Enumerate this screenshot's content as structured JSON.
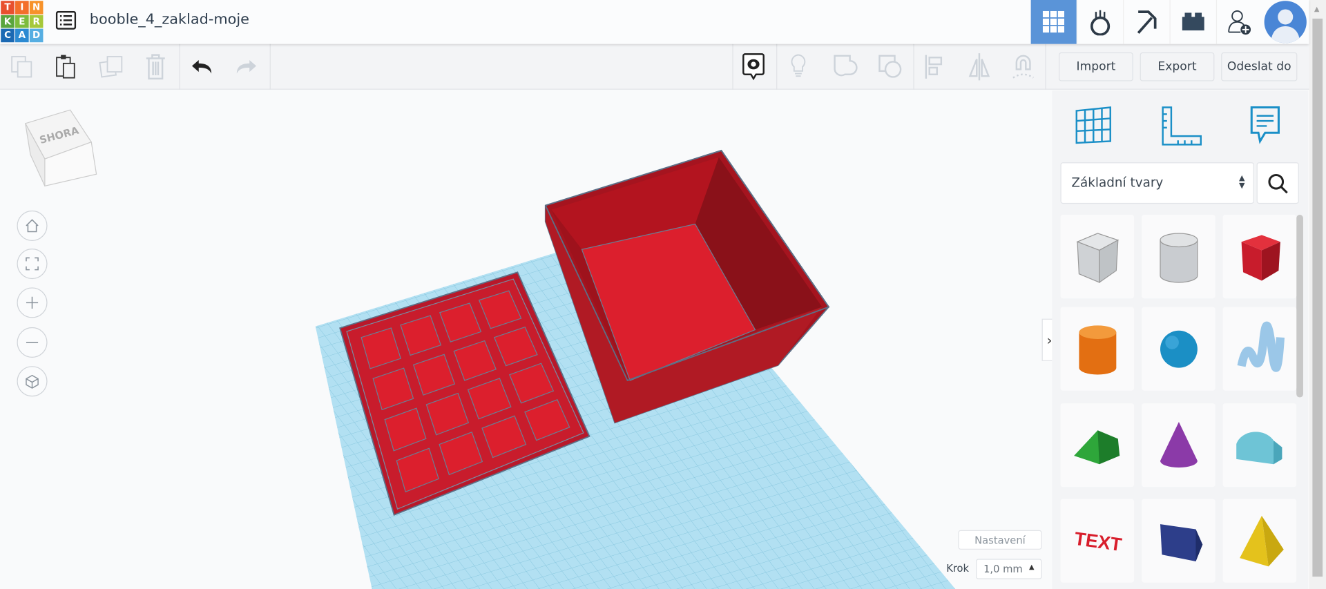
{
  "app": {
    "logo_letters": [
      "T",
      "I",
      "N",
      "K",
      "E",
      "R",
      "C",
      "A",
      "D"
    ],
    "logo_colors": [
      "#e8502e",
      "#f36f2a",
      "#f7922a",
      "#5aa53d",
      "#7dbc3d",
      "#a6c83a",
      "#1b69b3",
      "#2c8ad2",
      "#56aee2"
    ],
    "title": "booble_4_zaklad-moje"
  },
  "header_icons": [
    "grid-3d-design-icon",
    "circuits-icon",
    "minecraft-pickaxe-icon",
    "lego-brick-icon",
    "add-user-icon",
    "avatar"
  ],
  "toolbar": {
    "import": "Import",
    "export": "Export",
    "send_to": "Odeslat do"
  },
  "viewcube": {
    "label": "SHORA"
  },
  "panel": {
    "category": "Základní tvary"
  },
  "bottom": {
    "settings": "Nastavení",
    "step_label": "Krok",
    "step_value": "1,0 mm"
  },
  "colors": {
    "accent": "#5a94d8",
    "shape_red": "#dc1f2d",
    "workplane": "#a9dcef"
  }
}
